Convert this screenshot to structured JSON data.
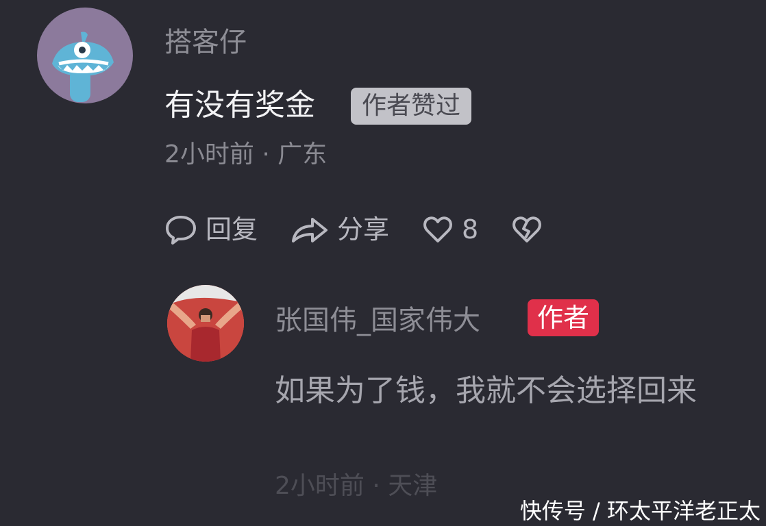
{
  "comment": {
    "username": "搭客仔",
    "text": "有没有奖金",
    "liked_badge": "作者赞过",
    "meta": "2小时前 · 广东",
    "actions": {
      "reply": "回复",
      "share": "分享",
      "like_count": "8"
    }
  },
  "reply": {
    "username": "张国伟_国家伟大",
    "author_badge": "作者",
    "text": "如果为了钱，我就不会选择回来",
    "meta": "2小时前 · 天津"
  },
  "watermark": "快传号 / 环太平洋老正太",
  "colors": {
    "background": "#2a2a32",
    "author_badge": "#e0304a",
    "liked_badge": "#c2c2c8"
  }
}
